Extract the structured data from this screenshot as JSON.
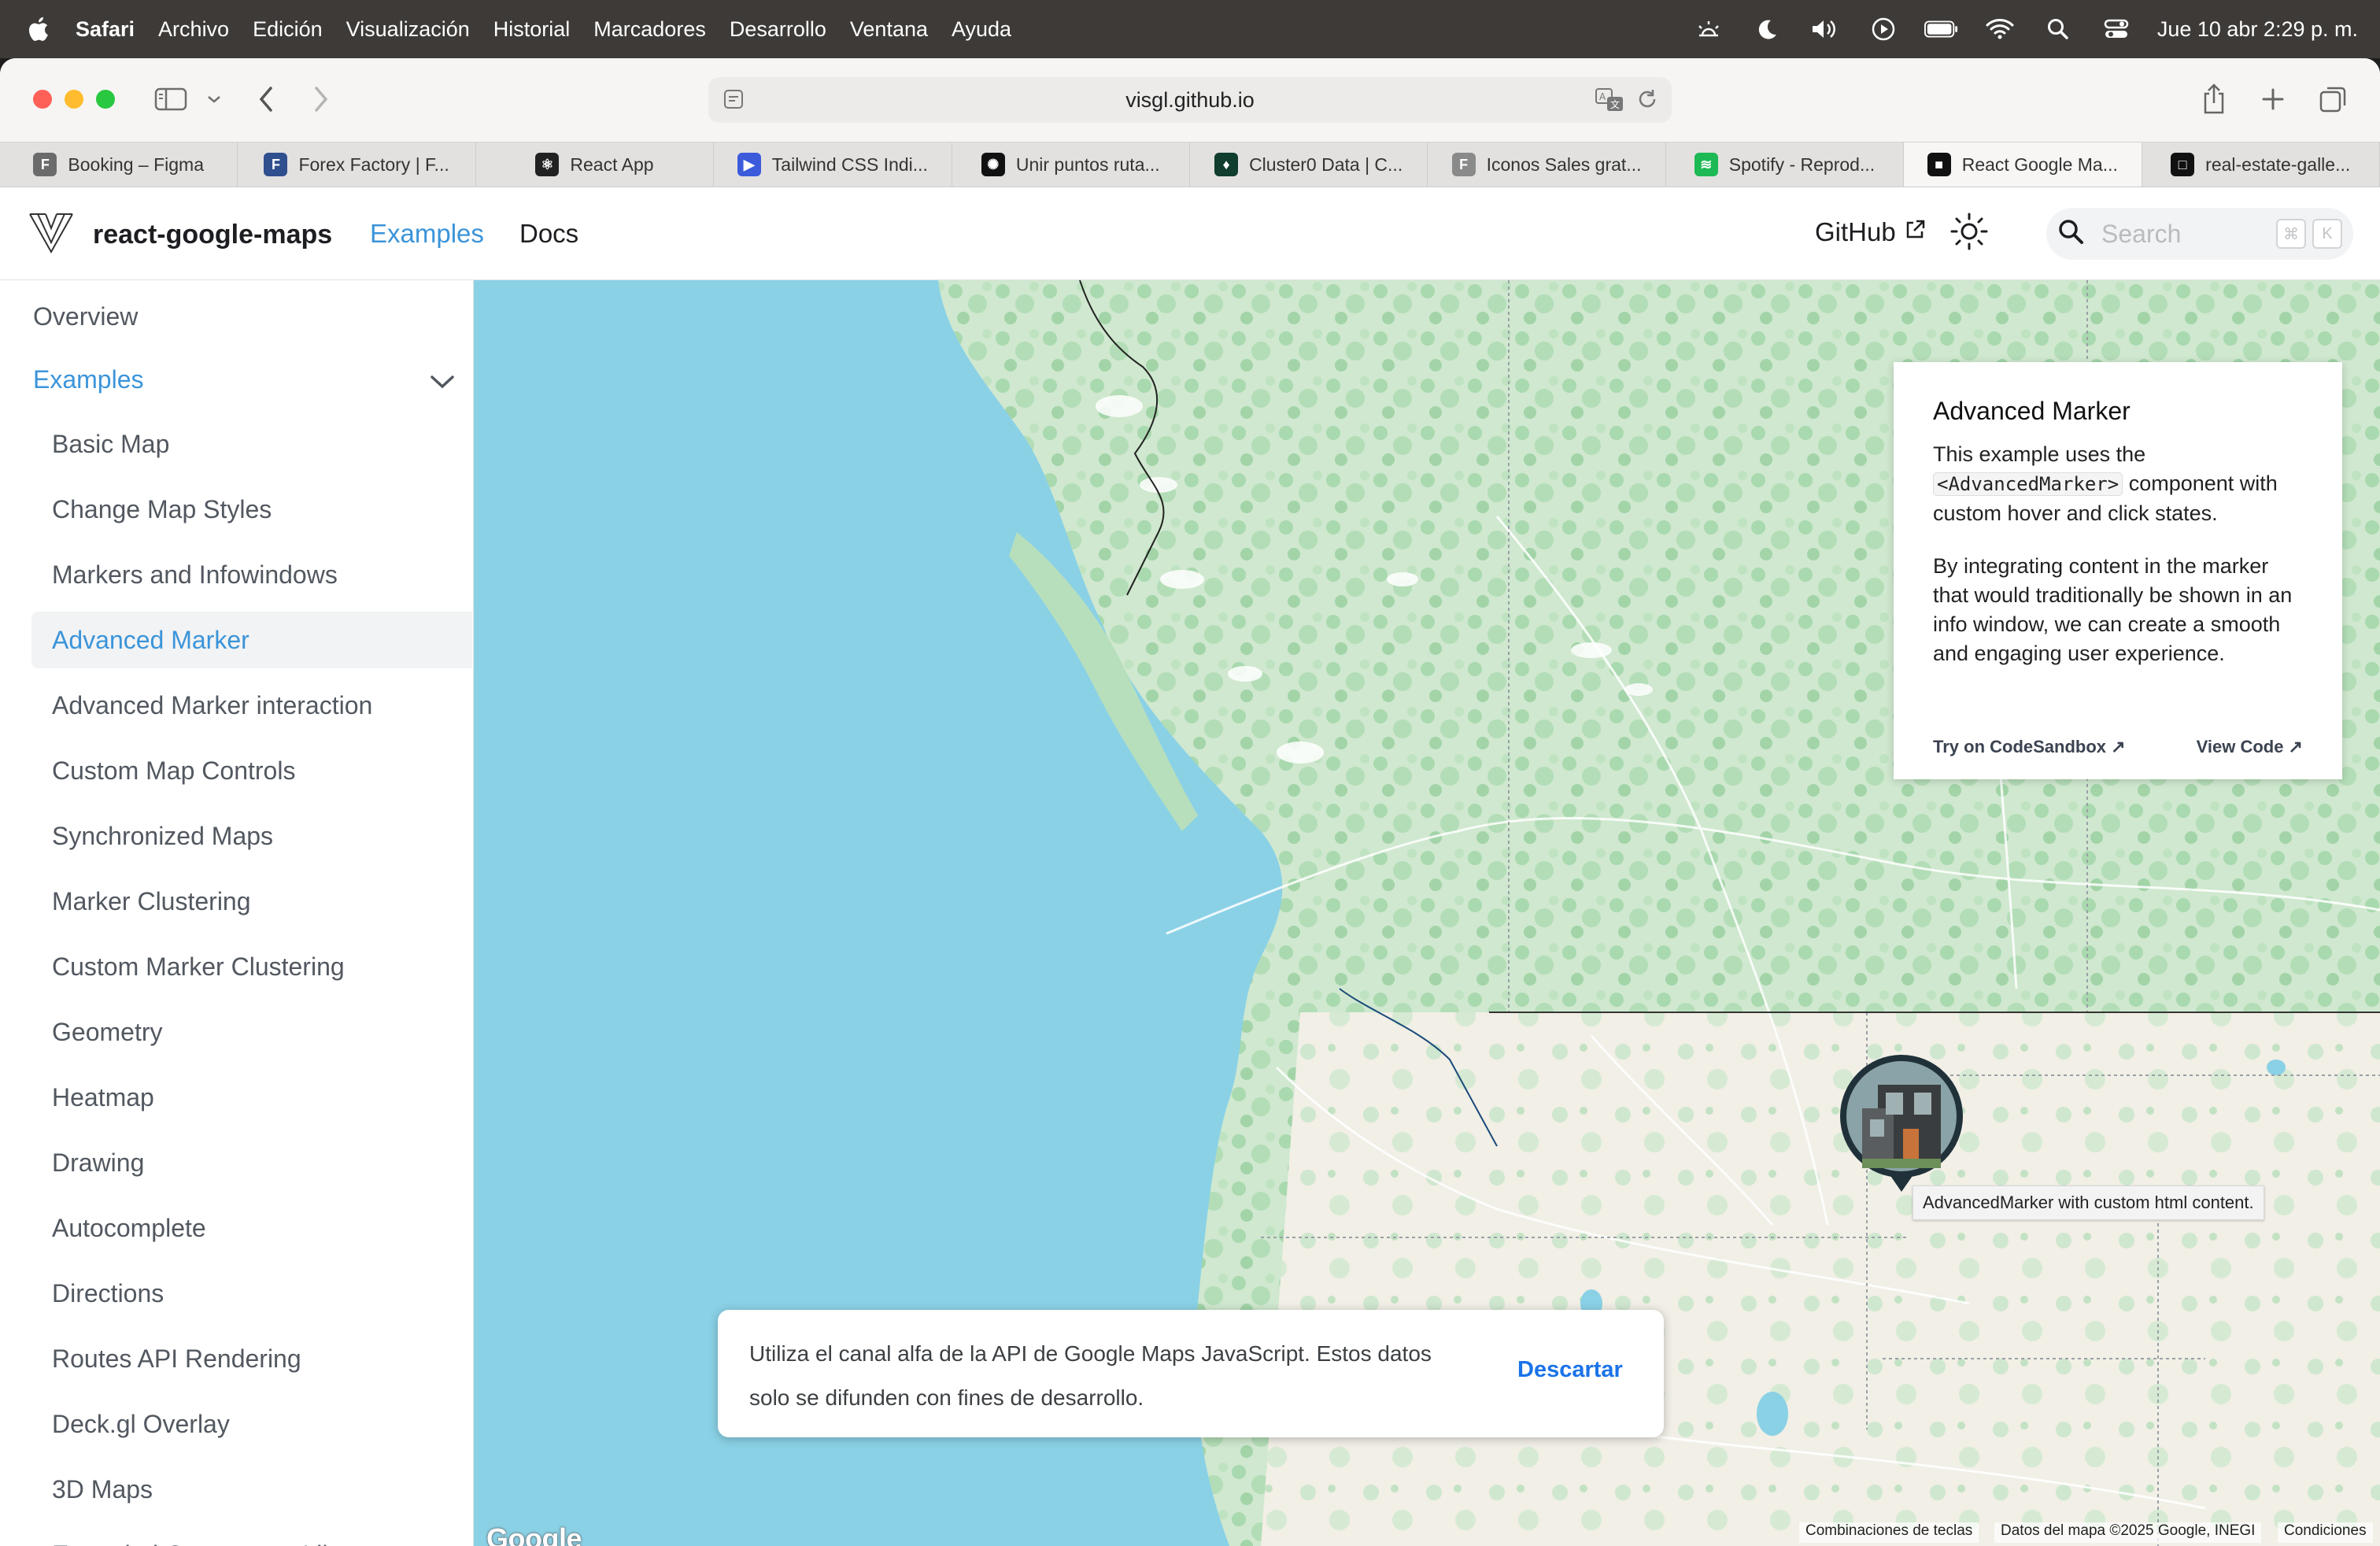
{
  "menubar": {
    "app_name": "Safari",
    "items": [
      "Archivo",
      "Edición",
      "Visualización",
      "Historial",
      "Marcadores",
      "Desarrollo",
      "Ventana",
      "Ayuda"
    ],
    "clock": "Jue 10 abr  2:29 p. m."
  },
  "browser": {
    "address": "visgl.github.io",
    "tabs": [
      {
        "label": "Booking – Figma",
        "favicon_color": "#6b6b6b",
        "favicon_char": "F"
      },
      {
        "label": "Forex Factory | F...",
        "favicon_color": "#2f4f8f",
        "favicon_char": "F"
      },
      {
        "label": "React App",
        "favicon_color": "#222222",
        "favicon_char": "⚛"
      },
      {
        "label": "Tailwind CSS Indi...",
        "favicon_color": "#3b5bdb",
        "favicon_char": "▶"
      },
      {
        "label": "Unir puntos ruta...",
        "favicon_color": "#111111",
        "favicon_char": "✺"
      },
      {
        "label": "Cluster0 Data | C...",
        "favicon_color": "#0f3d2e",
        "favicon_char": "♦"
      },
      {
        "label": "Iconos Sales grat...",
        "favicon_color": "#8a8a8a",
        "favicon_char": "F"
      },
      {
        "label": "Spotify - Reprod...",
        "favicon_color": "#1db954",
        "favicon_char": "≋"
      },
      {
        "label": "React Google Ma...",
        "favicon_color": "#111111",
        "favicon_char": "■"
      },
      {
        "label": "real-estate-galle...",
        "favicon_color": "#111111",
        "favicon_char": "□"
      }
    ],
    "active_tab_index": 8
  },
  "site": {
    "brand": "react-google-maps",
    "nav_examples": "Examples",
    "nav_docs": "Docs",
    "github": "GitHub",
    "search_placeholder": "Search",
    "search_key1": "⌘",
    "search_key2": "K",
    "accent_color": "#3b94d9"
  },
  "sidebar": {
    "overview": "Overview",
    "examples": "Examples",
    "items": [
      "Basic Map",
      "Change Map Styles",
      "Markers and Infowindows",
      "Advanced Marker",
      "Advanced Marker interaction",
      "Custom Map Controls",
      "Synchronized Maps",
      "Marker Clustering",
      "Custom Marker Clustering",
      "Geometry",
      "Heatmap",
      "Drawing",
      "Autocomplete",
      "Directions",
      "Routes API Rendering",
      "Deck.gl Overlay",
      "3D Maps",
      "Extended Component Library"
    ],
    "active_item": "Advanced Marker"
  },
  "info_panel": {
    "title": "Advanced Marker",
    "p1_before": "This example uses the ",
    "p1_code": "<AdvancedMarker>",
    "p1_after": " component with custom hover and click states.",
    "p2": "By integrating content in the marker that would traditionally be shown in an info window, we can create a smooth and engaging user experience.",
    "link_sandbox": "Try on CodeSandbox ↗",
    "link_code": "View Code ↗"
  },
  "map": {
    "tooltip": "AdvancedMarker with custom html content.",
    "banner_text": "Utiliza el canal alfa de la API de Google Maps JavaScript. Estos datos solo se difunden con fines de desarrollo.",
    "banner_dismiss": "Descartar",
    "logo": "Google",
    "attrib_shortcuts": "Combinaciones de teclas",
    "attrib_data": "Datos del mapa ©2025 Google, INEGI",
    "attrib_terms": "Condiciones"
  }
}
